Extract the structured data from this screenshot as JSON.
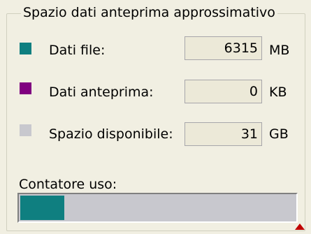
{
  "group": {
    "title": "Spazio dati anteprima approssimativo"
  },
  "rows": [
    {
      "label": "Dati file:",
      "value": "6315",
      "unit": "MB",
      "color": "#0f7f80"
    },
    {
      "label": "Dati anteprima:",
      "value": "0",
      "unit": "KB",
      "color": "#800080"
    },
    {
      "label": "Spazio disponibile:",
      "value": "31",
      "unit": "GB",
      "color": "#c8c8ce"
    }
  ],
  "usage": {
    "label": "Contatore uso:",
    "fill_fraction": 0.16,
    "fill_color": "#0f7f80",
    "track_color": "#c8c8ce",
    "marker_color": "#c00000"
  }
}
